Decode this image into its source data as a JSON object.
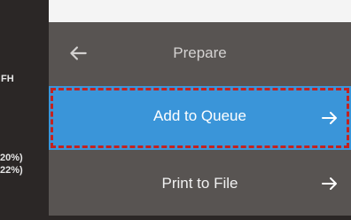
{
  "left_panel": {
    "label_fh": "FH",
    "percent_1": "20%)",
    "percent_2": "22%)"
  },
  "header": {
    "title": "Prepare",
    "back_icon": "arrow-left-icon"
  },
  "menu": {
    "items": [
      {
        "label": "Add to Queue",
        "icon": "arrow-right-icon",
        "highlighted": true
      },
      {
        "label": "Print to File",
        "icon": "arrow-right-icon",
        "highlighted": false
      }
    ]
  },
  "colors": {
    "highlight": "#3a95d9",
    "panel": "#585452",
    "focus_outline": "#c4221f"
  }
}
